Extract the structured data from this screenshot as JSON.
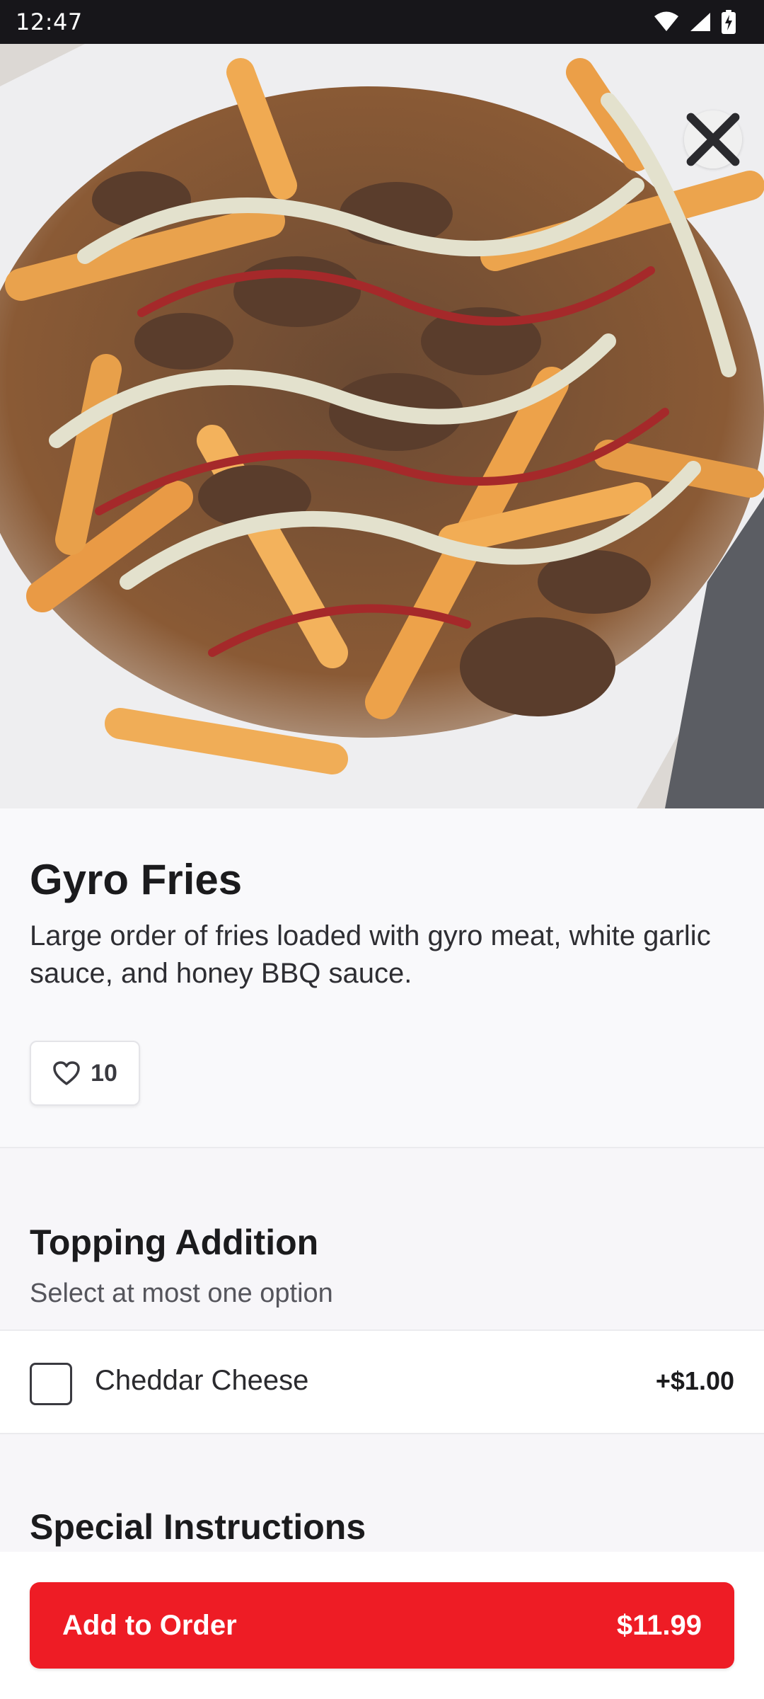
{
  "status_bar": {
    "time": "12:47",
    "icons": [
      "wifi-icon",
      "signal-icon",
      "battery-charging-icon"
    ]
  },
  "hero": {
    "image": "gyro-fries-photo",
    "close_icon": "close-icon"
  },
  "item": {
    "title": "Gyro Fries",
    "description": "Large order of fries loaded with gyro meat, white garlic sauce, and honey BBQ sauce.",
    "likes": "10",
    "like_icon": "heart-outline-icon"
  },
  "topping_section": {
    "title": "Topping Addition",
    "subtitle": "Select at most one option",
    "options": [
      {
        "label": "Cheddar Cheese",
        "price": "+$1.00",
        "checked": false
      }
    ]
  },
  "special_instructions": {
    "title": "Special Instructions"
  },
  "bottom_bar": {
    "add_label": "Add to Order",
    "price": "$11.99"
  },
  "colors": {
    "accent": "#ee1c25",
    "status_bar": "#17161a",
    "background": "#f7f6f9"
  }
}
